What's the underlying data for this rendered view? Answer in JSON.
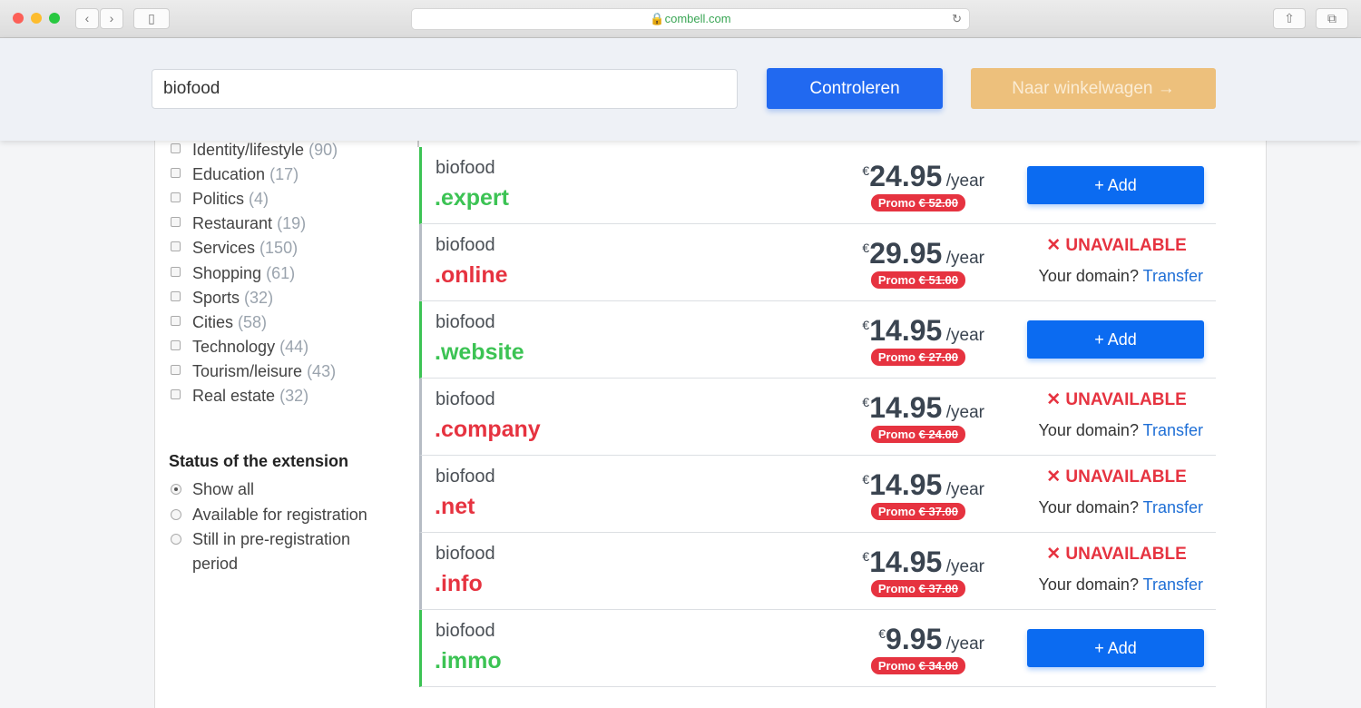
{
  "browser": {
    "url": "combell.com",
    "back_icon": "‹",
    "forward_icon": "›"
  },
  "header": {
    "search_value": "biofood",
    "check_label": "Controleren",
    "cart_label": "Naar winkelwagen →"
  },
  "sidebar": {
    "categories": [
      {
        "label": "Identity/lifestyle",
        "count": "(90)"
      },
      {
        "label": "Education",
        "count": "(17)"
      },
      {
        "label": "Politics",
        "count": "(4)"
      },
      {
        "label": "Restaurant",
        "count": "(19)"
      },
      {
        "label": "Services",
        "count": "(150)"
      },
      {
        "label": "Shopping",
        "count": "(61)"
      },
      {
        "label": "Sports",
        "count": "(32)"
      },
      {
        "label": "Cities",
        "count": "(58)"
      },
      {
        "label": "Technology",
        "count": "(44)"
      },
      {
        "label": "Tourism/leisure",
        "count": "(43)"
      },
      {
        "label": "Real estate",
        "count": "(32)"
      }
    ],
    "status_heading": "Status of the extension",
    "status_options": [
      {
        "label": "Show all",
        "selected": true
      },
      {
        "label": "Available for registration",
        "selected": false
      },
      {
        "label": "Still in pre-registration period",
        "selected": false
      }
    ]
  },
  "results": {
    "currency": "€",
    "per": "/year",
    "promo_label": "Promo",
    "add_label": "+ Add",
    "unavailable_label": "✕ UNAVAILABLE",
    "your_domain": "Your domain?",
    "transfer_label": "Transfer",
    "colors": {
      "available": "#3cc354",
      "unavailable": "#e63340",
      "primary": "#0b6bf1"
    },
    "rows": [
      {
        "name": "biofood",
        "ext": ".expert",
        "price": "24.95",
        "old": "€ 52.00",
        "available": true
      },
      {
        "name": "biofood",
        "ext": ".online",
        "price": "29.95",
        "old": "€ 51.00",
        "available": false
      },
      {
        "name": "biofood",
        "ext": ".website",
        "price": "14.95",
        "old": "€ 27.00",
        "available": true
      },
      {
        "name": "biofood",
        "ext": ".company",
        "price": "14.95",
        "old": "€ 24.00",
        "available": false
      },
      {
        "name": "biofood",
        "ext": ".net",
        "price": "14.95",
        "old": "€ 37.00",
        "available": false
      },
      {
        "name": "biofood",
        "ext": ".info",
        "price": "14.95",
        "old": "€ 37.00",
        "available": false
      },
      {
        "name": "biofood",
        "ext": ".immo",
        "price": "9.95",
        "old": "€ 34.00",
        "available": true
      }
    ]
  }
}
